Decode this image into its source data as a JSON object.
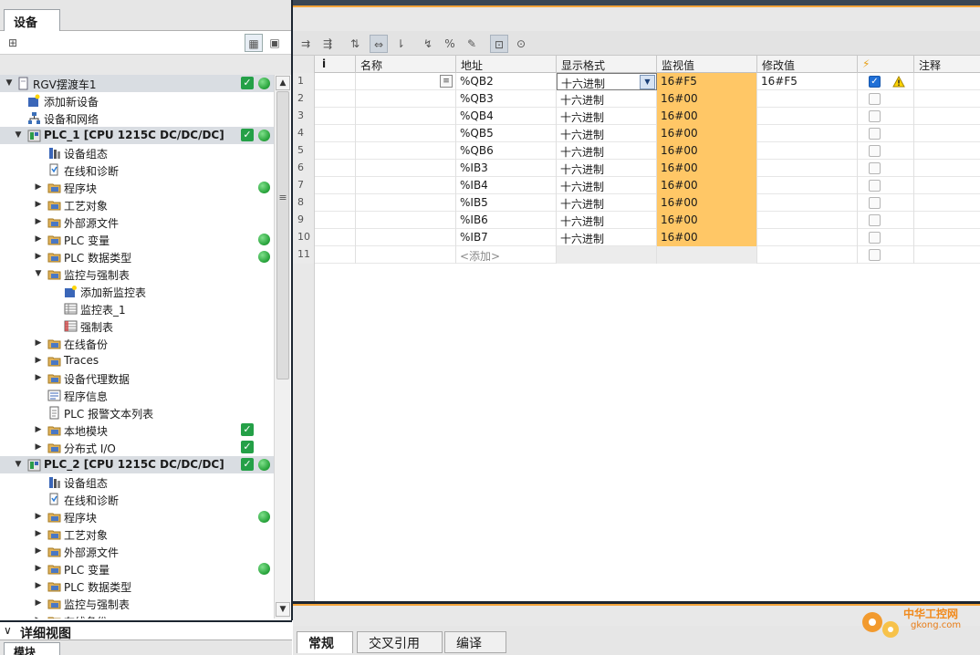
{
  "left_panel": {
    "tab": "设备",
    "detail_view": "详细视图",
    "detail_tab": "模块"
  },
  "tree": [
    {
      "label": "RGV摆渡车1",
      "exp": "▼",
      "icon": "project-icon",
      "check": true,
      "dot": true,
      "sel": true
    },
    {
      "label": "添加新设备",
      "exp": "",
      "icon": "add-device-icon"
    },
    {
      "label": "设备和网络",
      "exp": "",
      "icon": "network-icon"
    },
    {
      "label": "PLC_1 [CPU 1215C DC/DC/DC]",
      "exp": "▼",
      "icon": "plc-icon",
      "check": true,
      "dot": true,
      "sel": true
    },
    {
      "label": "设备组态",
      "exp": "",
      "icon": "device-config-icon"
    },
    {
      "label": "在线和诊断",
      "exp": "",
      "icon": "online-diag-icon"
    },
    {
      "label": "程序块",
      "exp": "▶",
      "icon": "folder-icon",
      "dot": true
    },
    {
      "label": "工艺对象",
      "exp": "▶",
      "icon": "folder-icon"
    },
    {
      "label": "外部源文件",
      "exp": "▶",
      "icon": "folder-icon"
    },
    {
      "label": "PLC 变量",
      "exp": "▶",
      "icon": "folder-icon",
      "dot": true
    },
    {
      "label": "PLC 数据类型",
      "exp": "▶",
      "icon": "folder-icon",
      "dot": true
    },
    {
      "label": "监控与强制表",
      "exp": "▼",
      "icon": "folder-icon"
    },
    {
      "label": "添加新监控表",
      "exp": "",
      "icon": "add-table-icon"
    },
    {
      "label": "监控表_1",
      "exp": "",
      "icon": "watch-table-icon"
    },
    {
      "label": "强制表",
      "exp": "",
      "icon": "force-table-icon"
    },
    {
      "label": "在线备份",
      "exp": "▶",
      "icon": "folder-icon"
    },
    {
      "label": "Traces",
      "exp": "▶",
      "icon": "folder-icon"
    },
    {
      "label": "设备代理数据",
      "exp": "▶",
      "icon": "folder-icon"
    },
    {
      "label": "程序信息",
      "exp": "",
      "icon": "program-info-icon"
    },
    {
      "label": "PLC 报警文本列表",
      "exp": "",
      "icon": "text-list-icon"
    },
    {
      "label": "本地模块",
      "exp": "▶",
      "icon": "folder-icon",
      "check": true
    },
    {
      "label": "分布式 I/O",
      "exp": "▶",
      "icon": "folder-icon",
      "check": true
    },
    {
      "label": "PLC_2 [CPU 1215C DC/DC/DC]",
      "exp": "▼",
      "icon": "plc-icon",
      "check": true,
      "dot": true,
      "sel": true
    },
    {
      "label": "设备组态",
      "exp": "",
      "icon": "device-config-icon"
    },
    {
      "label": "在线和诊断",
      "exp": "",
      "icon": "online-diag-icon"
    },
    {
      "label": "程序块",
      "exp": "▶",
      "icon": "folder-icon",
      "dot": true
    },
    {
      "label": "工艺对象",
      "exp": "▶",
      "icon": "folder-icon"
    },
    {
      "label": "外部源文件",
      "exp": "▶",
      "icon": "folder-icon"
    },
    {
      "label": "PLC 变量",
      "exp": "▶",
      "icon": "folder-icon",
      "dot": true
    },
    {
      "label": "PLC 数据类型",
      "exp": "▶",
      "icon": "folder-icon"
    },
    {
      "label": "监控与强制表",
      "exp": "▶",
      "icon": "folder-icon"
    },
    {
      "label": "在线备份",
      "exp": "▶",
      "icon": "folder-icon"
    }
  ],
  "table": {
    "headers": {
      "info": "i",
      "name": "名称",
      "address": "地址",
      "format": "显示格式",
      "monitor": "监视值",
      "modify": "修改值",
      "flash": "⚡",
      "comment": "注释"
    },
    "rows": [
      {
        "n": "1",
        "address": "%QB2",
        "format": "十六进制",
        "monitor": "16#F5",
        "modify": "16#F5",
        "checked": true,
        "warn": true
      },
      {
        "n": "2",
        "address": "%QB3",
        "format": "十六进制",
        "monitor": "16#00",
        "modify": "",
        "checked": false
      },
      {
        "n": "3",
        "address": "%QB4",
        "format": "十六进制",
        "monitor": "16#00",
        "modify": "",
        "checked": false
      },
      {
        "n": "4",
        "address": "%QB5",
        "format": "十六进制",
        "monitor": "16#00",
        "modify": "",
        "checked": false
      },
      {
        "n": "5",
        "address": "%QB6",
        "format": "十六进制",
        "monitor": "16#00",
        "modify": "",
        "checked": false
      },
      {
        "n": "6",
        "address": "%IB3",
        "format": "十六进制",
        "monitor": "16#00",
        "modify": "",
        "checked": false
      },
      {
        "n": "7",
        "address": "%IB4",
        "format": "十六进制",
        "monitor": "16#00",
        "modify": "",
        "checked": false
      },
      {
        "n": "8",
        "address": "%IB5",
        "format": "十六进制",
        "monitor": "16#00",
        "modify": "",
        "checked": false
      },
      {
        "n": "9",
        "address": "%IB6",
        "format": "十六进制",
        "monitor": "16#00",
        "modify": "",
        "checked": false
      },
      {
        "n": "10",
        "address": "%IB7",
        "format": "十六进制",
        "monitor": "16#00",
        "modify": "",
        "checked": false
      }
    ],
    "add_row": {
      "n": "11",
      "address": "<添加>"
    }
  },
  "bottom_tabs": [
    "常规",
    "交叉引用",
    "编译"
  ],
  "watermark": {
    "line1": "中华工控网",
    "line2": "gkong.com"
  },
  "colors": {
    "monitor": "#ffc766",
    "accent": "#f4a43a",
    "ok": "#24a047"
  }
}
